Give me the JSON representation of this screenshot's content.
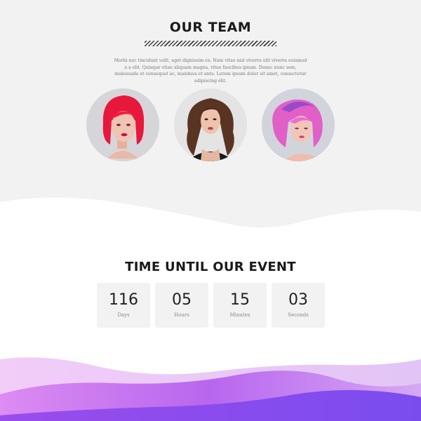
{
  "team": {
    "title": "OUR TEAM",
    "description": "Morbi nec tincidunt velit, eget dignissim ex. Nam vitae nisl viverra elit viverra euismod a a elit. Quisque vitae aliquam magna, vitae faucibus ipsum. Donec nunc sem, malesuada ut consequat ac, maximus et ante. Lorem ipsum dolor sit amet, consectetur adipiscing elit.",
    "members": [
      {
        "photo": "woman-red-bob-hair"
      },
      {
        "photo": "woman-brown-curly-hair"
      },
      {
        "photo": "woman-pink-wavy-hair"
      }
    ]
  },
  "event": {
    "title": "TIME UNTIL OUR EVENT",
    "countdown": [
      {
        "value": "116",
        "label": "Days"
      },
      {
        "value": "05",
        "label": "Hours"
      },
      {
        "value": "15",
        "label": "Minutes"
      },
      {
        "value": "03",
        "label": "Seconds"
      }
    ]
  },
  "colors": {
    "section_bg": "#f2f2f2",
    "wave_light": "#e9c2f7",
    "wave_mid": "#c678f0",
    "wave_dark": "#8a4cf0"
  }
}
